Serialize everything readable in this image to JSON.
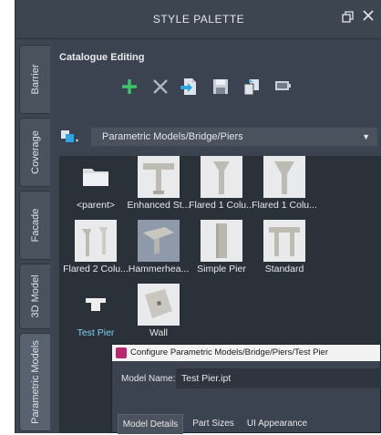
{
  "window": {
    "title": "STYLE PALETTE"
  },
  "side_tabs": [
    {
      "label": "Barrier",
      "active": false
    },
    {
      "label": "Coverage",
      "active": false
    },
    {
      "label": "Facade",
      "active": false
    },
    {
      "label": "3D Model",
      "active": false
    },
    {
      "label": "Parametric Models",
      "active": true
    }
  ],
  "catalogue": {
    "title": "Catalogue Editing",
    "toolbar": [
      "add-icon",
      "delete-icon",
      "import-icon",
      "save-icon",
      "copy-icon",
      "display-icon"
    ]
  },
  "path": {
    "value": "Parametric Models/Bridge/Piers"
  },
  "items": [
    {
      "label": "<parent>",
      "icon": "folder-icon"
    },
    {
      "label": "Enhanced St...",
      "icon": "enhanced-pier-icon"
    },
    {
      "label": "Flared 1 Colu...",
      "icon": "flared-pier-icon"
    },
    {
      "label": "Flared 1 Colu...",
      "icon": "flared-pier-icon"
    },
    {
      "label": "Flared 2 Colu...",
      "icon": "double-column-pier-icon"
    },
    {
      "label": "Hammerhea...",
      "icon": "hammerhead-pier-icon"
    },
    {
      "label": "Simple Pier",
      "icon": "simple-pier-icon"
    },
    {
      "label": "Standard",
      "icon": "standard-pier-icon"
    },
    {
      "label": "Test Pier",
      "icon": "test-pier-icon",
      "highlighted": true
    },
    {
      "label": "Wall",
      "icon": "wall-icon"
    }
  ],
  "dialog": {
    "title": "Configure Parametric Models/Bridge/Piers/Test Pier",
    "model_name_label": "Model Name:",
    "model_name_value": "Test Pier.ipt",
    "tabs": [
      {
        "label": "Model Details",
        "active": true
      },
      {
        "label": "Part Sizes",
        "active": false
      },
      {
        "label": "UI Appearance",
        "active": false
      }
    ]
  },
  "colors": {
    "accent_add": "#3fc36a",
    "panel": "#3b4350",
    "list_bg": "#2b3139",
    "highlight_text": "#7fd0f0"
  }
}
